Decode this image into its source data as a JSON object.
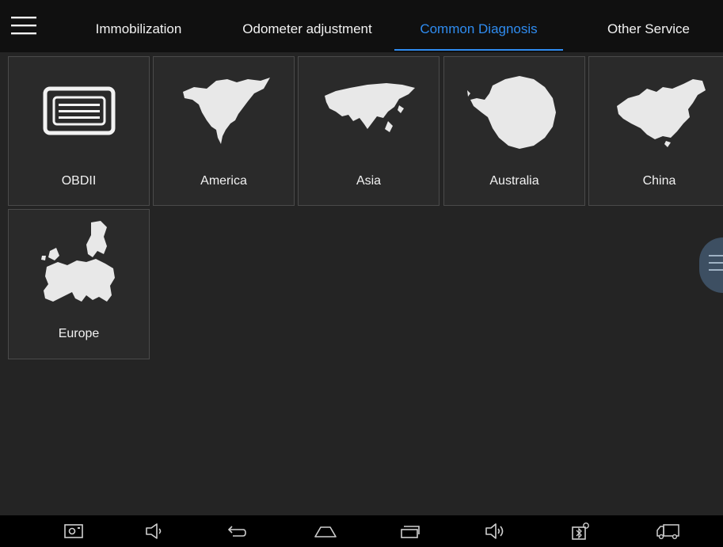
{
  "tabs": [
    {
      "label": "Immobilization",
      "active": false
    },
    {
      "label": "Odometer adjustment",
      "active": false
    },
    {
      "label": "Common Diagnosis",
      "active": true
    },
    {
      "label": "Other Service",
      "active": false
    }
  ],
  "tiles": [
    {
      "label": "OBDII",
      "icon": "obd-connector-icon"
    },
    {
      "label": "America",
      "icon": "north-america-map-icon"
    },
    {
      "label": "Asia",
      "icon": "asia-map-icon"
    },
    {
      "label": "Australia",
      "icon": "antarctica-map-icon"
    },
    {
      "label": "China",
      "icon": "china-map-icon"
    },
    {
      "label": "Europe",
      "icon": "europe-map-icon"
    }
  ],
  "colors": {
    "accent": "#2f8cf0",
    "background": "#242424",
    "topbar": "#101010",
    "tile": "#2a2a2a",
    "navbar": "#000000"
  },
  "navbar_icons": [
    "screenshot-icon",
    "volume-down-icon",
    "back-icon",
    "home-icon",
    "recent-apps-icon",
    "volume-up-icon",
    "bluetooth-settings-icon",
    "truck-icon"
  ]
}
